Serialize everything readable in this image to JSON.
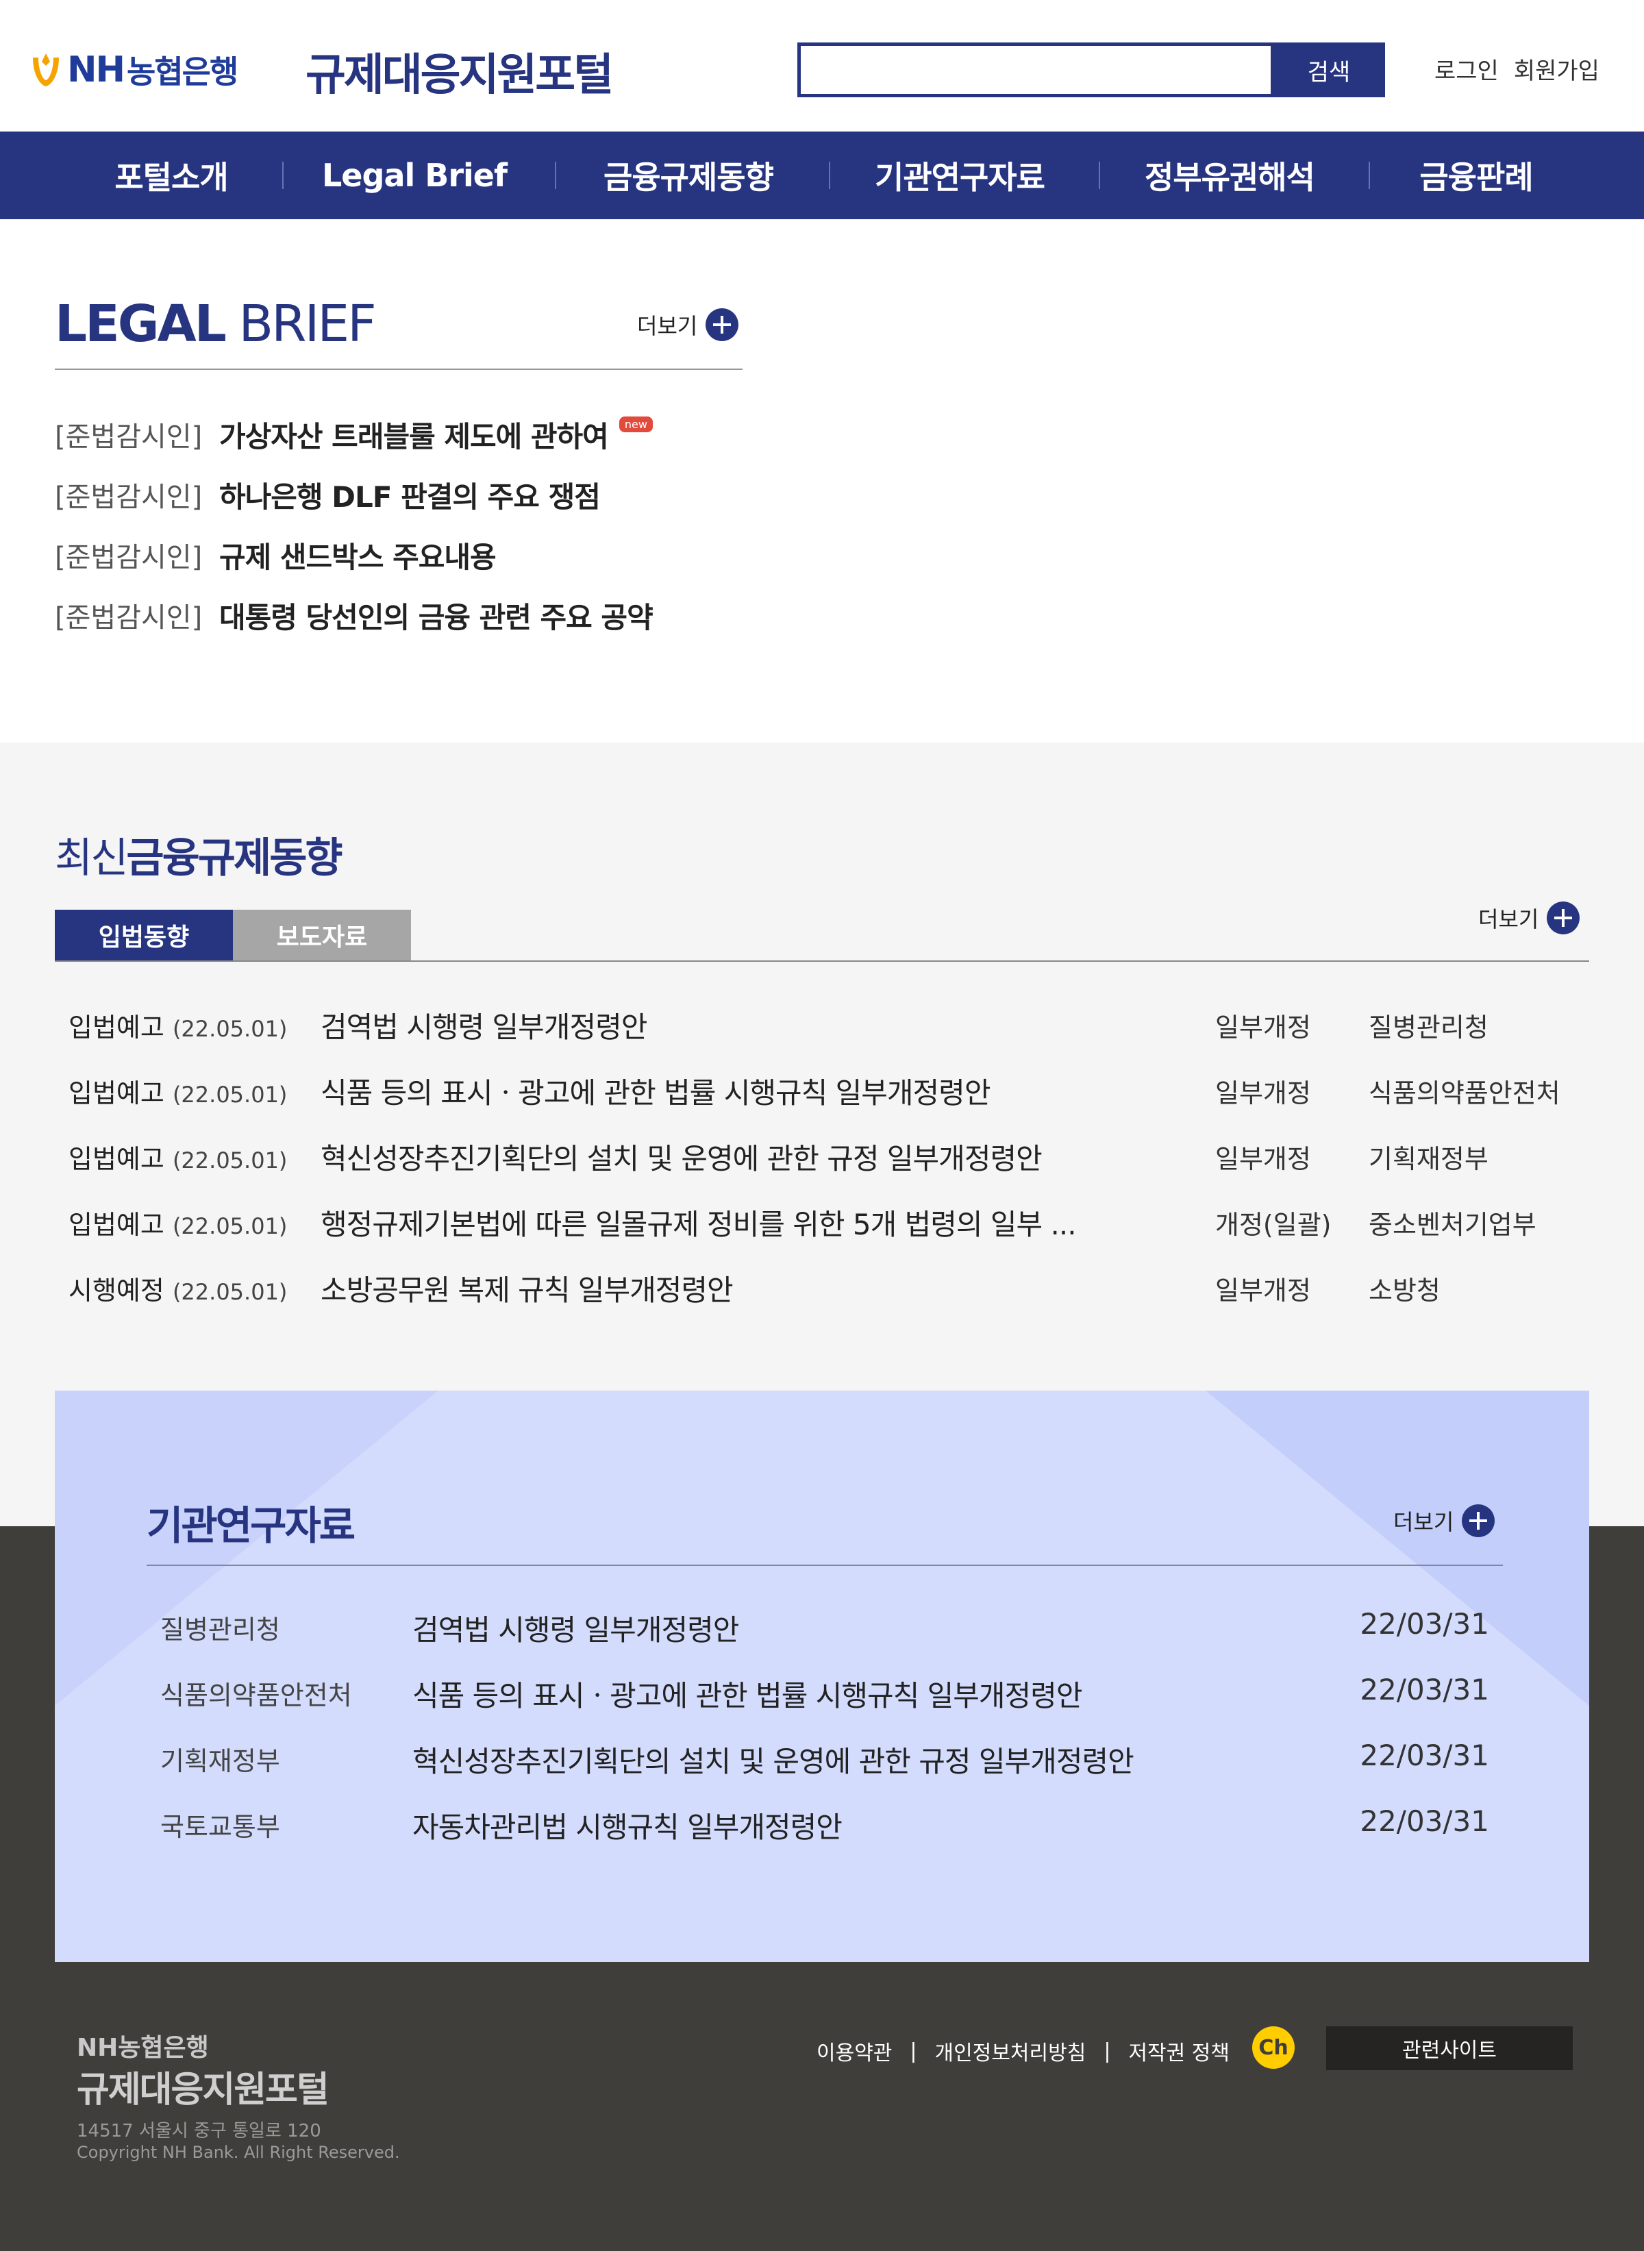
{
  "header": {
    "logo_nh": "NH",
    "logo_bank": "농협은행",
    "site_title": "규제대응지원포털",
    "search_placeholder": "",
    "search_button": "검색",
    "login": "로그인",
    "signup": "회원가입"
  },
  "nav": {
    "items": [
      "포털소개",
      "Legal Brief",
      "금융규제동향",
      "기관연구자료",
      "정부유권해석",
      "금융판례"
    ]
  },
  "legal_brief": {
    "title_bold": "LEGAL",
    "title_light": "BRIEF",
    "more": "더보기",
    "new_badge": "new",
    "items": [
      {
        "category": "[준법감시인]",
        "title": "가상자산 트래블룰 제도에 관하여"
      },
      {
        "category": "[준법감시인]",
        "title": "하나은행 DLF 판결의 주요 쟁점"
      },
      {
        "category": "[준법감시인]",
        "title": "규제 샌드박스 주요내용"
      },
      {
        "category": "[준법감시인]",
        "title": "대통령 당선인의 금융 관련 주요 공약"
      }
    ]
  },
  "regulation": {
    "title_light": "최신",
    "title_bold": "금융규제동향",
    "tabs": [
      "입법동향",
      "보도자료"
    ],
    "more": "더보기",
    "rows": [
      {
        "type": "입법예고",
        "date": "(22.05.01)",
        "title": "검역법 시행령 일부개정령안",
        "kind": "일부개정",
        "org": "질병관리청"
      },
      {
        "type": "입법예고",
        "date": "(22.05.01)",
        "title": "식품 등의 표시ㆍ광고에 관한 법률 시행규칙 일부개정령안",
        "kind": "일부개정",
        "org": "식품의약품안전처"
      },
      {
        "type": "입법예고",
        "date": "(22.05.01)",
        "title": "혁신성장추진기획단의 설치 및 운영에 관한 규정 일부개정령안",
        "kind": "일부개정",
        "org": "기획재정부"
      },
      {
        "type": "입법예고",
        "date": "(22.05.01)",
        "title": "행정규제기본법에 따른 일몰규제 정비를 위한 5개 법령의 일부 ...",
        "kind": "개정(일괄)",
        "org": "중소벤처기업부"
      },
      {
        "type": "시행예정",
        "date": "(22.05.01)",
        "title": "소방공무원 복제 규칙 일부개정령안",
        "kind": "일부개정",
        "org": "소방청"
      }
    ]
  },
  "research": {
    "title": "기관연구자료",
    "more": "더보기",
    "rows": [
      {
        "org": "질병관리청",
        "title": "검역법 시행령 일부개정령안",
        "date": "22/03/31"
      },
      {
        "org": "식품의약품안전처",
        "title": "식품 등의 표시ㆍ광고에 관한 법률 시행규칙 일부개정령안",
        "date": "22/03/31"
      },
      {
        "org": "기획재정부",
        "title": "혁신성장추진기획단의 설치 및 운영에 관한 규정 일부개정령안",
        "date": "22/03/31"
      },
      {
        "org": "국토교통부",
        "title": "자동차관리법 시행규칙 일부개정령안",
        "date": "22/03/31"
      }
    ]
  },
  "footer": {
    "logo": "NH농협은행",
    "title": "규제대응지원포털",
    "address": "14517 서울시 중구 통일로 120",
    "copyright": "Copyright NH Bank. All Right Reserved.",
    "links": [
      "이용약관",
      "개인정보처리방침",
      "저작권 정책"
    ],
    "channel_icon_text": "Ch",
    "related_sites": "관련사이트"
  },
  "colors": {
    "primary": "#273581",
    "light_card": "#d4dcfd",
    "footer_bg": "#3f3e3b",
    "badge_red": "#e24b3b",
    "kakao_yellow": "#ffcd00"
  }
}
